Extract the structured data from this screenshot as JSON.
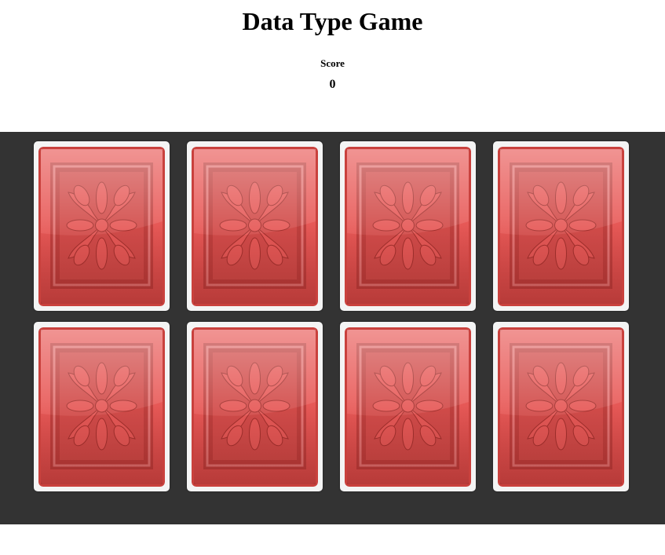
{
  "header": {
    "title": "Data Type Game",
    "score_label": "Score",
    "score_value": "0"
  },
  "board": {
    "background": "#333333",
    "cards": [
      {
        "state": "face-down"
      },
      {
        "state": "face-down"
      },
      {
        "state": "face-down"
      },
      {
        "state": "face-down"
      },
      {
        "state": "face-down"
      },
      {
        "state": "face-down"
      },
      {
        "state": "face-down"
      },
      {
        "state": "face-down"
      }
    ],
    "card_back_icon": "ornament-icon",
    "card_colors": {
      "edge": "#c9413d",
      "base": "#e85a58",
      "dark": "#9e2e2b",
      "light": "#f08a8a"
    }
  }
}
